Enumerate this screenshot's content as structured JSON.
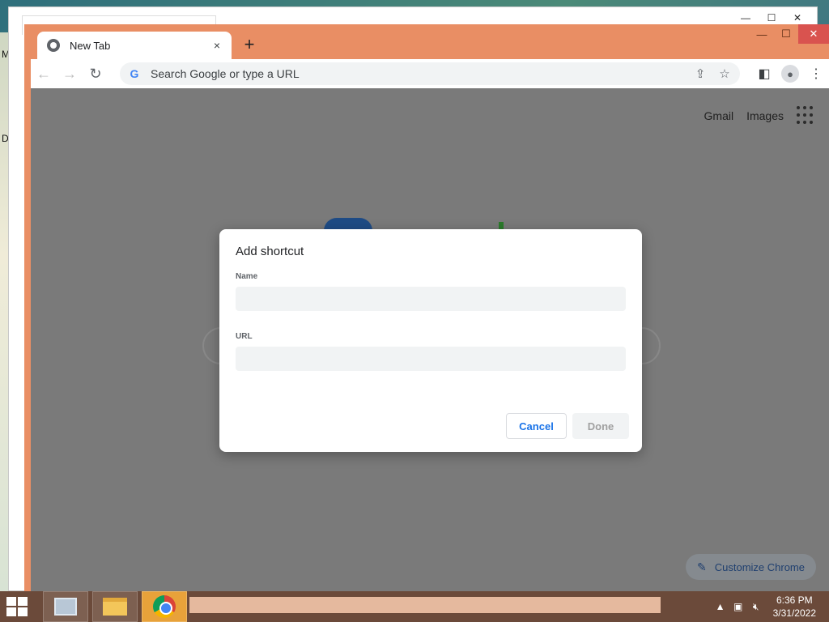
{
  "desktop": {
    "letters": [
      "M",
      "D"
    ]
  },
  "browser": {
    "tab_title": "New Tab",
    "tab_close": "×",
    "new_tab": "+",
    "omnibox_placeholder": "Search Google or type a URL",
    "win_controls": {
      "minimize": "—",
      "maximize": "☐",
      "close": "✕"
    }
  },
  "page": {
    "gmail": "Gmail",
    "images": "Images",
    "customize": "Customize Chrome"
  },
  "dialog": {
    "title": "Add shortcut",
    "name_label": "Name",
    "name_value": "",
    "url_label": "URL",
    "url_value": "",
    "cancel": "Cancel",
    "done": "Done"
  },
  "taskbar": {
    "time": "6:36 PM",
    "date": "3/31/2022"
  }
}
